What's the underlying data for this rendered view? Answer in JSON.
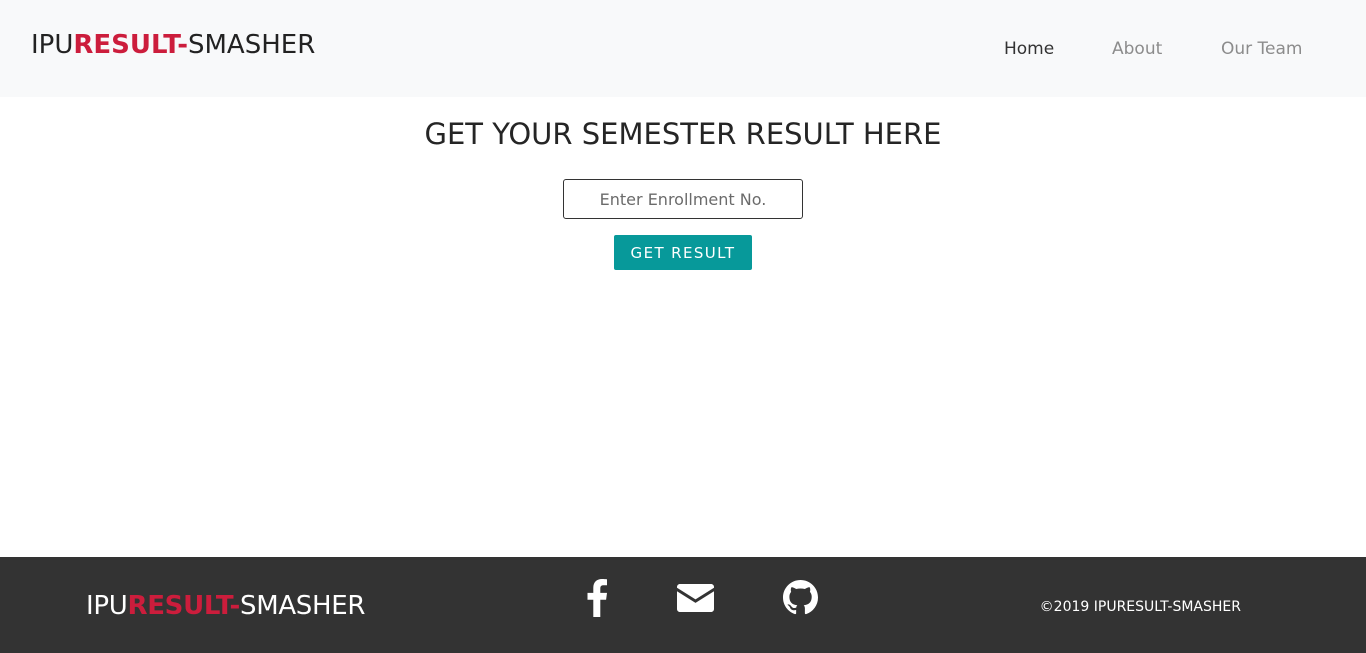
{
  "header": {
    "brand": {
      "part1": "IPU",
      "part2": "RESULT-",
      "part3": "SMASHER"
    },
    "nav": [
      {
        "label": "Home",
        "active": true
      },
      {
        "label": "About",
        "active": false
      },
      {
        "label": "Our Team",
        "active": false
      }
    ]
  },
  "main": {
    "title": "GET YOUR SEMESTER RESULT HERE",
    "enrollment_input": {
      "placeholder": "Enter Enrollment No.",
      "value": ""
    },
    "submit_label": "GET RESULT"
  },
  "footer": {
    "brand": {
      "part1": "IPU",
      "part2": "RESULT-",
      "part3": "SMASHER"
    },
    "social_icons": [
      "facebook-icon",
      "envelope-icon",
      "github-icon"
    ],
    "copyright": "©2019 IPURESULT-SMASHER"
  },
  "colors": {
    "brand_accent": "#cc1d3c",
    "button": "#07999a",
    "header_bg": "#f8f9fa",
    "footer_bg": "#333333"
  }
}
